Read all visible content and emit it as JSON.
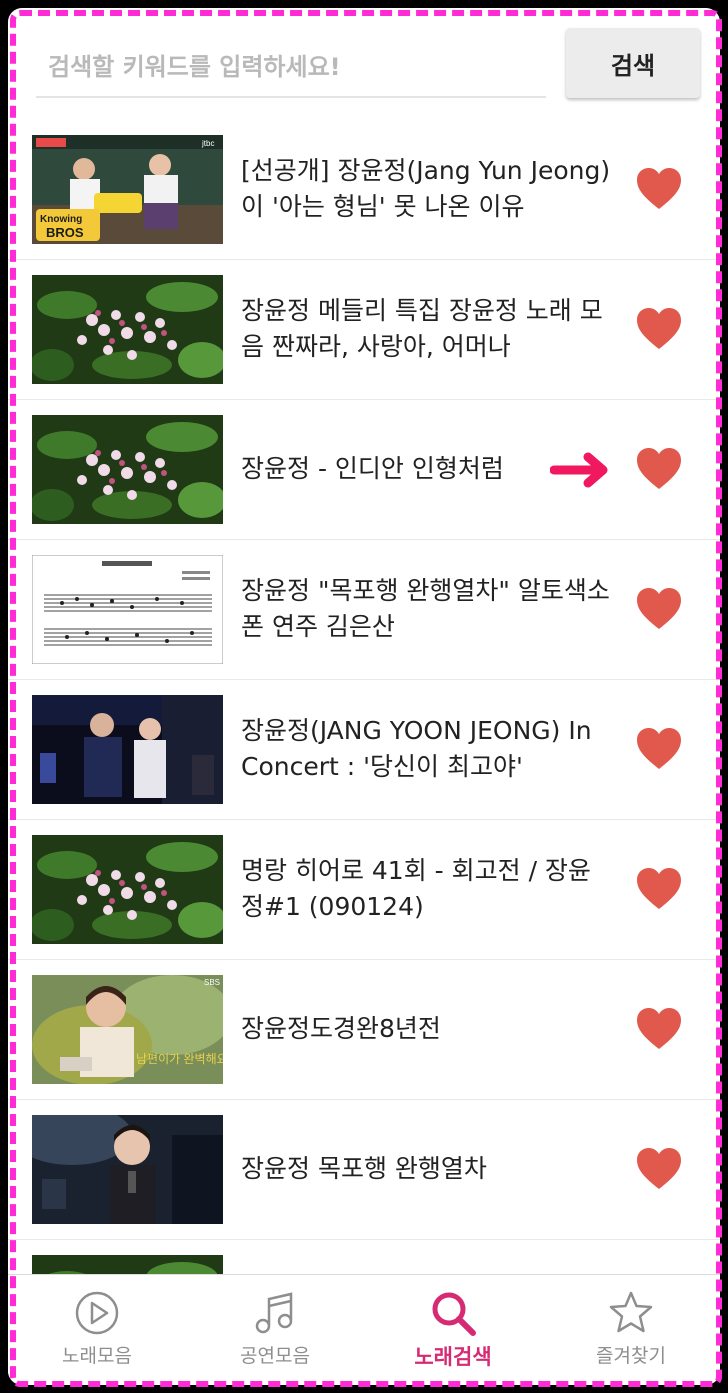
{
  "search": {
    "placeholder": "검색할 키워드를 입력하세요!",
    "button_label": "검색"
  },
  "results": [
    {
      "title": "[선공개] 장윤정(Jang Yun Jeong)이 '아는 형님' 못 나온 이유",
      "thumb": "knowing-bros"
    },
    {
      "title": "장윤정 메들리 특집 장윤정 노래 모음 짠짜라, 사랑아, 어머나",
      "thumb": "flowers"
    },
    {
      "title": "장윤정 - 인디안 인형처럼",
      "thumb": "flowers",
      "pointer": true
    },
    {
      "title": "장윤정 \"목포행 완행열차\" 알토색소폰 연주 김은산",
      "thumb": "sheet-music"
    },
    {
      "title": "장윤정(JANG YOON JEONG) In Concert : '당신이 최고야'",
      "thumb": "concert-stage"
    },
    {
      "title": "명랑 히어로 41회 - 회고전 / 장윤정#1 (090124)",
      "thumb": "flowers"
    },
    {
      "title": "장윤정도경완8년전",
      "thumb": "sbs-interview"
    },
    {
      "title": "장윤정 목포행 완행열차",
      "thumb": "singer-mic"
    },
    {
      "title": "",
      "thumb": "flowers"
    }
  ],
  "bottom_nav": [
    {
      "label": "노래모음",
      "icon": "play-circle-icon",
      "active": false
    },
    {
      "label": "공연모음",
      "icon": "music-note-icon",
      "active": false
    },
    {
      "label": "노래검색",
      "icon": "search-icon",
      "active": true
    },
    {
      "label": "즐겨찾기",
      "icon": "star-icon",
      "active": false
    }
  ],
  "colors": {
    "heart": "#e0594c",
    "accent": "#d62a73",
    "pointer_arrow": "#f0185e",
    "frame_dash": "#ff2bd6"
  }
}
